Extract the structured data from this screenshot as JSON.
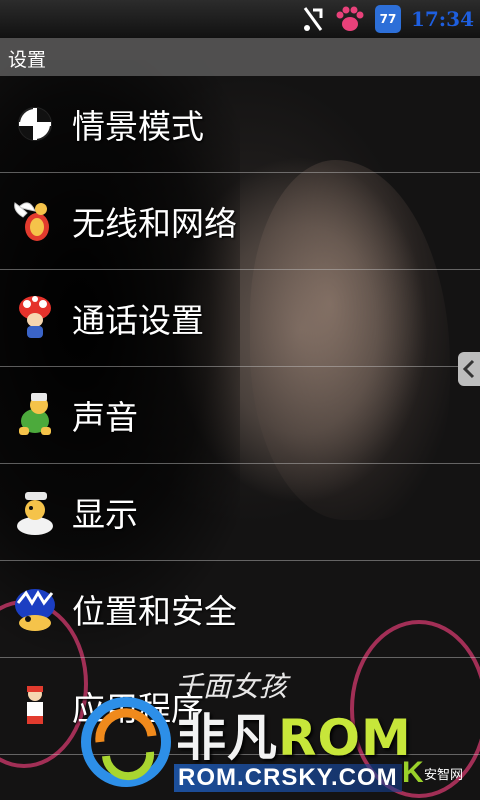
{
  "status_bar": {
    "time": "17:34",
    "battery_badge": "77",
    "icons": [
      "usb-debug-icon",
      "paw-icon",
      "android-battery-icon"
    ]
  },
  "title_bar": {
    "title": "设置"
  },
  "settings": {
    "items": [
      {
        "label": "情景模式",
        "icon": "profile-icon"
      },
      {
        "label": "无线和网络",
        "icon": "wireless-icon"
      },
      {
        "label": "通话设置",
        "icon": "call-icon"
      },
      {
        "label": "声音",
        "icon": "sound-icon"
      },
      {
        "label": "显示",
        "icon": "display-icon"
      },
      {
        "label": "位置和安全",
        "icon": "location-security-icon"
      },
      {
        "label": "应用程序",
        "icon": "applications-icon"
      }
    ]
  },
  "wallpaper": {
    "overlay_text": "千面女孩"
  },
  "watermark": {
    "brand_cn": "非凡",
    "brand_en": "ROM",
    "url": "ROM.CRSKY.COM",
    "k_letter": "K",
    "partner": "安智网"
  },
  "colors": {
    "clock": "#1e5fe0",
    "rom_green": "#c7e63a",
    "badge_blue": "#2d6fd8"
  }
}
